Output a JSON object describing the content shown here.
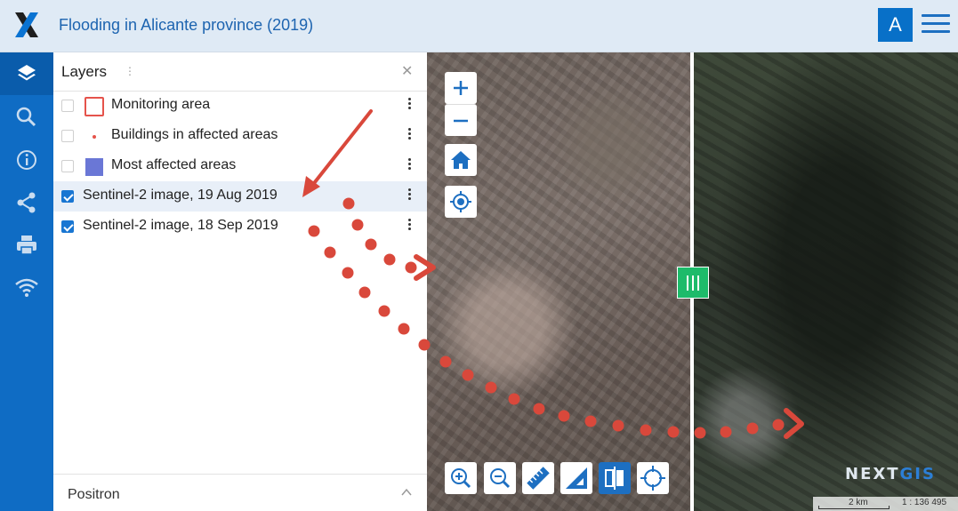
{
  "app": {
    "title": "Flooding in Alicante province (2019)",
    "avatar_letter": "A",
    "brand_color": "#0f6cc4"
  },
  "rail": {
    "items": [
      {
        "name": "layers-icon",
        "active": true
      },
      {
        "name": "search-icon"
      },
      {
        "name": "info-icon"
      },
      {
        "name": "share-icon"
      },
      {
        "name": "print-icon"
      },
      {
        "name": "wifi-icon"
      }
    ]
  },
  "panel": {
    "title": "Layers",
    "layers": [
      {
        "label": "Monitoring area",
        "checked": false,
        "symbol": "outline-square",
        "color": "#e5534b"
      },
      {
        "label": "Buildings in affected areas",
        "checked": false,
        "symbol": "dot",
        "color": "#e5534b"
      },
      {
        "label": "Most affected areas",
        "checked": false,
        "symbol": "filled-square",
        "color": "#6a77d6"
      },
      {
        "label": "Sentinel-2 image, 19 Aug 2019",
        "checked": true,
        "selected": true
      },
      {
        "label": "Sentinel-2 image, 18 Sep 2019",
        "checked": true
      }
    ],
    "basemap": "Positron"
  },
  "map": {
    "controls": [
      "zoom-in",
      "zoom-out",
      "home",
      "locate"
    ],
    "tools": [
      "zoom-in-tool",
      "zoom-out-tool",
      "ruler",
      "area-measure",
      "swipe",
      "crosshair"
    ],
    "brand": {
      "prefix": "N",
      "mid": "E",
      "rest": "XT",
      "accent": "GIS"
    },
    "scale_label": "2 km",
    "scale_ratio": "1 : 136 495",
    "swipe_color": "#1dbb6a",
    "annotation_color": "#d9483b"
  }
}
